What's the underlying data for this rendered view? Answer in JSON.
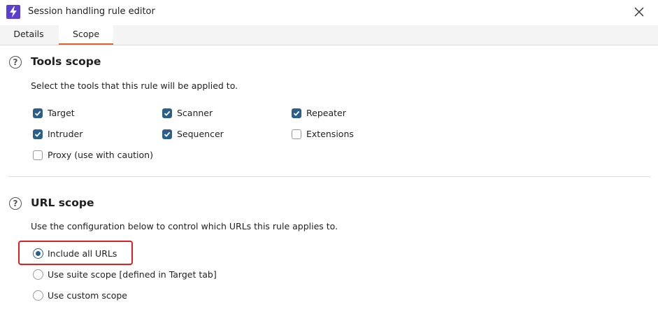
{
  "window": {
    "title": "Session handling rule editor",
    "app_icon": "lightning-icon",
    "close_icon": "close-icon"
  },
  "tabs": [
    {
      "label": "Details",
      "selected": false
    },
    {
      "label": "Scope",
      "selected": true
    }
  ],
  "tools_scope": {
    "title": "Tools scope",
    "description": "Select the tools that this rule will be applied to.",
    "tools": [
      {
        "label": "Target",
        "checked": true
      },
      {
        "label": "Scanner",
        "checked": true
      },
      {
        "label": "Repeater",
        "checked": true
      },
      {
        "label": "Intruder",
        "checked": true
      },
      {
        "label": "Sequencer",
        "checked": true
      },
      {
        "label": "Extensions",
        "checked": false
      },
      {
        "label": "Proxy (use with caution)",
        "checked": false
      }
    ]
  },
  "url_scope": {
    "title": "URL scope",
    "description": "Use the configuration below to control which URLs this rule applies to.",
    "options": [
      {
        "label": "Include all URLs",
        "selected": true
      },
      {
        "label": "Use suite scope [defined in Target tab]",
        "selected": false
      },
      {
        "label": "Use custom scope",
        "selected": false
      }
    ],
    "help_symbol": "?"
  },
  "colors": {
    "accent": "#2a5f8c",
    "tab_underline": "#e8612c",
    "highlight": "#e02020",
    "app_icon_bg": "#5b3fd3"
  }
}
